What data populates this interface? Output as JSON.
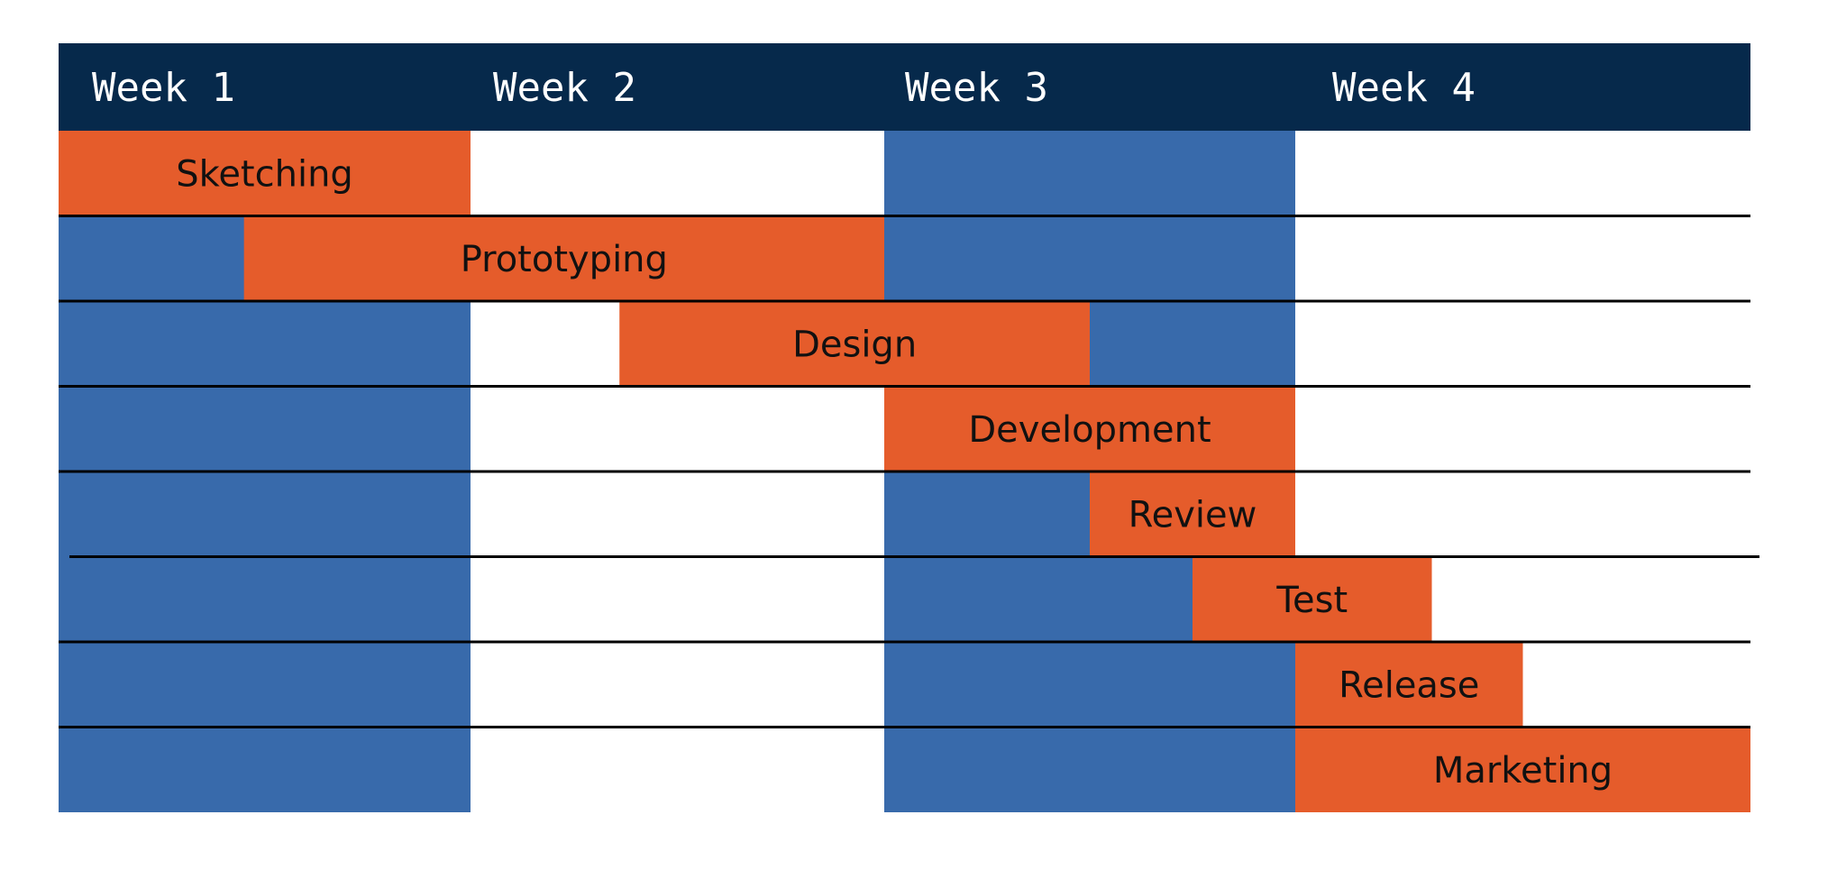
{
  "chart_data": {
    "type": "gantt",
    "title": "",
    "weeks": [
      "Week 1",
      "Week 2",
      "Week 3",
      "Week 4"
    ],
    "highlight_weeks": [
      0,
      2
    ],
    "tasks": [
      {
        "name": "Sketching",
        "start": 0.0,
        "end": 1.0
      },
      {
        "name": "Prototyping",
        "start": 0.45,
        "end": 2.0
      },
      {
        "name": "Design",
        "start": 1.36,
        "end": 2.5
      },
      {
        "name": "Development",
        "start": 2.0,
        "end": 3.0
      },
      {
        "name": "Review",
        "start": 2.5,
        "end": 3.0
      },
      {
        "name": "Test",
        "start": 2.75,
        "end": 3.3
      },
      {
        "name": "Release",
        "start": 3.0,
        "end": 3.5
      },
      {
        "name": "Marketing",
        "start": 3.0,
        "end": 4.0
      }
    ],
    "colors": {
      "header": "#06294b",
      "task": "#e55c2b",
      "week_band": "#386aab",
      "gridline": "#000000",
      "header_text": "#ffffff",
      "label_text": "#111111"
    }
  }
}
